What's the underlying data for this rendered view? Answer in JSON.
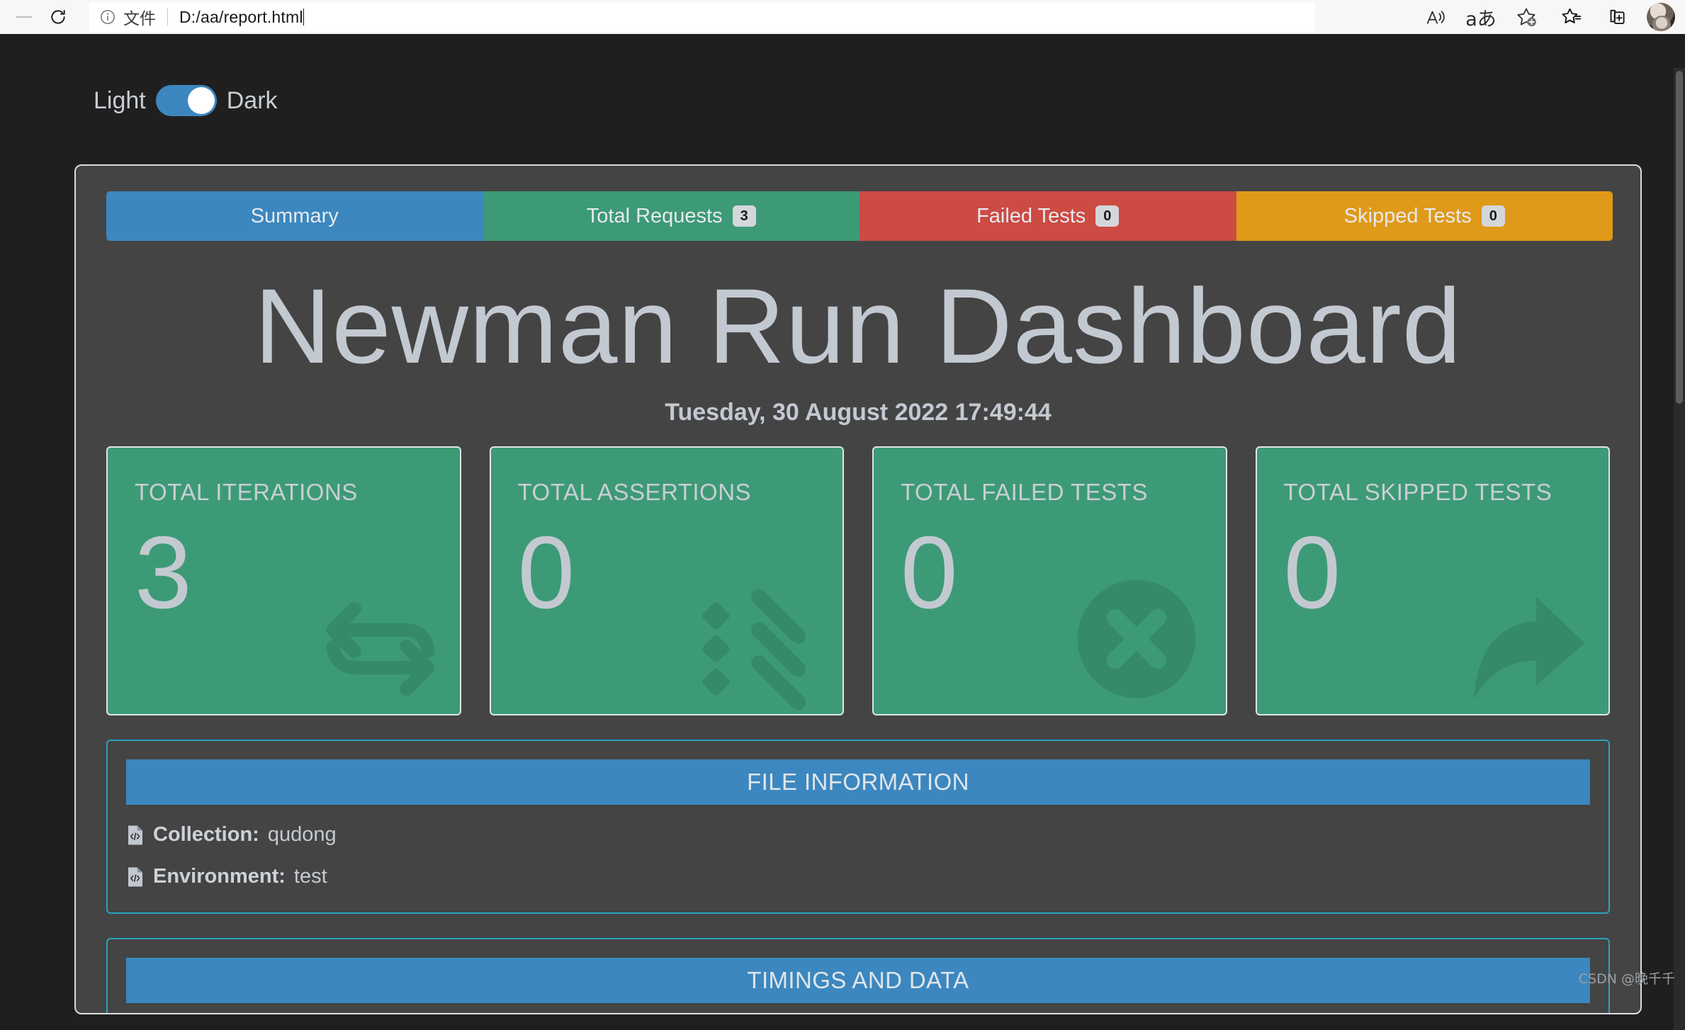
{
  "browser": {
    "back_icon": "back-arrow-icon",
    "reload_icon": "reload-icon",
    "info_icon": "info-circle-icon",
    "file_label": "文件",
    "url": "D:/aa/report.html",
    "actions": [
      {
        "name": "read-aloud-icon",
        "label": "A"
      },
      {
        "name": "translate-icon",
        "label": "aあ"
      },
      {
        "name": "add-favorite-icon",
        "label": "star-plus"
      },
      {
        "name": "favorites-icon",
        "label": "star-list"
      },
      {
        "name": "collections-icon",
        "label": "collections"
      },
      {
        "name": "profile-avatar",
        "label": "avatar"
      }
    ]
  },
  "theme": {
    "light_label": "Light",
    "dark_label": "Dark",
    "active": "Dark"
  },
  "tabs": [
    {
      "label": "Summary",
      "badge": null,
      "color": "#3c87bf",
      "active": true
    },
    {
      "label": "Total Requests",
      "badge": "3",
      "color": "#3d9a76",
      "active": false
    },
    {
      "label": "Failed Tests",
      "badge": "0",
      "color": "#cc4b43",
      "active": false
    },
    {
      "label": "Skipped Tests",
      "badge": "0",
      "color": "#e09a19",
      "active": false
    }
  ],
  "header": {
    "title": "Newman Run Dashboard",
    "date": "Tuesday, 30 August 2022 17:49:44"
  },
  "cards": [
    {
      "title": "TOTAL ITERATIONS",
      "value": "3",
      "icon": "sync-arrows-icon",
      "color": "#3d9a76"
    },
    {
      "title": "TOTAL ASSERTIONS",
      "value": "0",
      "icon": "tasks-icon",
      "color": "#3d9a76"
    },
    {
      "title": "TOTAL FAILED TESTS",
      "value": "0",
      "icon": "times-circle-icon",
      "color": "#3d9a76"
    },
    {
      "title": "TOTAL SKIPPED TESTS",
      "value": "0",
      "icon": "share-arrow-icon",
      "color": "#3d9a76"
    }
  ],
  "file_information": {
    "header": "FILE INFORMATION",
    "rows": [
      {
        "icon": "file-code-icon",
        "key": "Collection:",
        "value": "qudong"
      },
      {
        "icon": "file-code-icon",
        "key": "Environment:",
        "value": "test"
      }
    ]
  },
  "timings": {
    "header": "TIMINGS AND DATA"
  },
  "watermark": "CSDN @晚千千",
  "colors": {
    "page_background": "#1f1f1f",
    "container_background": "#444444",
    "accent_blue": "#3c87bf",
    "accent_green": "#3d9a76",
    "accent_red": "#cc4b43",
    "accent_orange": "#e09a19",
    "panel_border": "#2aa3bd",
    "text_light": "#c3c9d1"
  }
}
